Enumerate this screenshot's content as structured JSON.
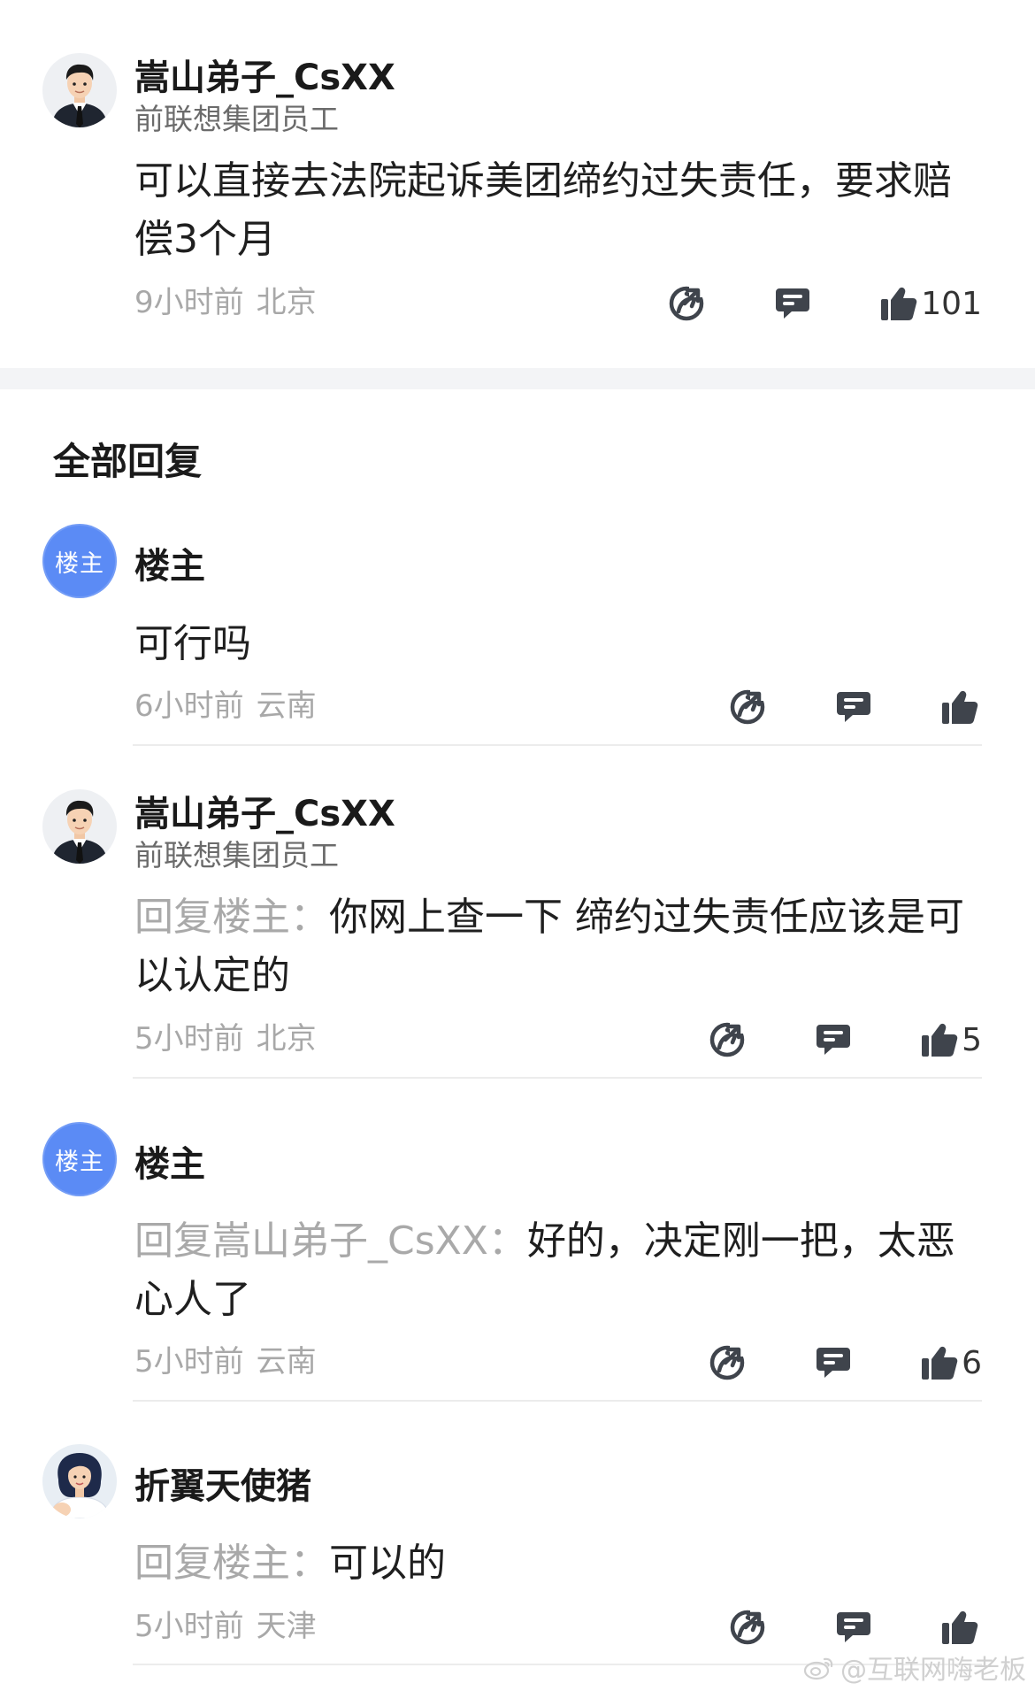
{
  "top_comment": {
    "username": "嵩山弟子_CsXX",
    "title": "前联想集团员工",
    "content": "可以直接去法院起诉美团缔约过失责任，要求赔偿3个月",
    "time": "9小时前",
    "location": "北京",
    "likes": "101"
  },
  "section_title": "全部回复",
  "replies": [
    {
      "avatar_text": "楼主",
      "username": "楼主",
      "reply_prefix": "",
      "content": "可行吗",
      "time": "6小时前",
      "location": "云南",
      "likes": ""
    },
    {
      "username": "嵩山弟子_CsXX",
      "title": "前联想集团员工",
      "reply_prefix": "回复楼主：",
      "content": "你网上查一下 缔约过失责任应该是可以认定的",
      "time": "5小时前",
      "location": "北京",
      "likes": "5"
    },
    {
      "avatar_text": "楼主",
      "username": "楼主",
      "reply_prefix": "回复嵩山弟子_CsXX：",
      "content": "好的，决定刚一把，太恶心人了",
      "time": "5小时前",
      "location": "云南",
      "likes": "6"
    },
    {
      "username": "折翼天使猪",
      "reply_prefix": "回复楼主：",
      "content": "可以的",
      "time": "5小时前",
      "location": "天津",
      "likes": ""
    }
  ],
  "watermark": "@互联网嗨老板",
  "colors": {
    "op_badge": "#5b8bf5",
    "icon": "#3f444c",
    "muted_text": "#a8a8a8",
    "divider": "#f3f4f6"
  },
  "icons": [
    "share-icon",
    "comment-icon",
    "thumbs-up-icon",
    "weibo-icon"
  ]
}
